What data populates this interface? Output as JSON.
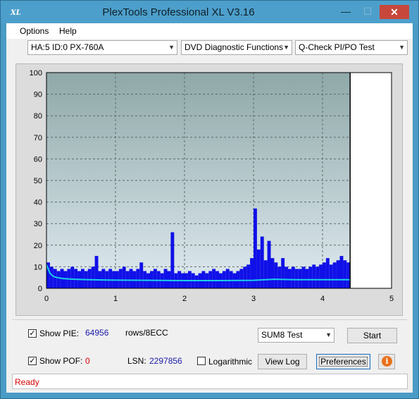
{
  "window": {
    "app_icon_text": "XL",
    "title": "PlexTools Professional XL V3.16",
    "minimize_glyph": "—",
    "maximize_glyph": "☐",
    "close_glyph": "✕"
  },
  "menu": {
    "options": "Options",
    "help": "Help"
  },
  "toolbar": {
    "drive": "HA:5 ID:0  PX-760A",
    "function": "DVD Diagnostic Functions",
    "test": "Q-Check PI/PO Test"
  },
  "chart_data": {
    "type": "area",
    "title": "",
    "xlabel": "",
    "ylabel": "",
    "xlim": [
      0,
      5
    ],
    "ylim": [
      0,
      100
    ],
    "x_ticks": [
      "0",
      "1",
      "2",
      "3",
      "4",
      "5"
    ],
    "y_ticks": [
      "100",
      "90",
      "80",
      "70",
      "60",
      "50",
      "40",
      "30",
      "20",
      "10",
      "0"
    ],
    "grid": true,
    "scan_end_x": 4.4,
    "colors": {
      "pie_bars": "#1010e8",
      "average_line": "#19d0e8",
      "background_top": "#8fa8a8",
      "background_bottom": "#dfeaf0"
    },
    "series": [
      {
        "values_x": [
          0.0,
          0.05,
          0.1,
          0.15,
          0.2,
          0.25,
          0.3,
          0.35,
          0.4,
          0.45,
          0.5,
          0.55,
          0.6,
          0.65,
          0.7,
          0.75,
          0.8,
          0.85,
          0.9,
          0.95,
          1.0,
          1.05,
          1.1,
          1.15,
          1.2,
          1.25,
          1.3,
          1.35,
          1.4,
          1.45,
          1.5,
          1.55,
          1.6,
          1.65,
          1.7,
          1.75,
          1.8,
          1.85,
          1.9,
          1.95,
          2.0,
          2.05,
          2.1,
          2.15,
          2.2,
          2.25,
          2.3,
          2.35,
          2.4,
          2.45,
          2.5,
          2.55,
          2.6,
          2.65,
          2.7,
          2.75,
          2.8,
          2.85,
          2.9,
          2.95,
          3.0,
          3.05,
          3.1,
          3.15,
          3.2,
          3.25,
          3.3,
          3.35,
          3.4,
          3.45,
          3.5,
          3.55,
          3.6,
          3.65,
          3.7,
          3.75,
          3.8,
          3.85,
          3.9,
          3.95,
          4.0,
          4.05,
          4.1,
          4.15,
          4.2,
          4.25,
          4.3,
          4.35,
          4.4
        ],
        "values_y": [
          12,
          10,
          9,
          8,
          9,
          8,
          9,
          10,
          9,
          8,
          9,
          8,
          9,
          10,
          15,
          8,
          9,
          8,
          9,
          8,
          8,
          9,
          10,
          8,
          9,
          8,
          9,
          12,
          8,
          7,
          8,
          9,
          8,
          7,
          9,
          8,
          26,
          7,
          8,
          7,
          7,
          8,
          7,
          6,
          7,
          8,
          7,
          8,
          9,
          8,
          7,
          8,
          9,
          8,
          7,
          8,
          9,
          10,
          11,
          14,
          37,
          18,
          24,
          13,
          22,
          14,
          12,
          10,
          14,
          10,
          9,
          10,
          9,
          9,
          10,
          9,
          10,
          11,
          10,
          11,
          12,
          14,
          11,
          12,
          13,
          15,
          13,
          12,
          10
        ]
      },
      {
        "values_x": [
          0.0,
          0.05,
          0.1,
          0.15,
          0.25,
          0.4,
          0.6,
          0.8,
          1.0,
          1.5,
          2.0,
          2.5,
          3.0,
          3.3,
          3.6,
          4.0,
          4.4
        ],
        "values_y": [
          11,
          7,
          5.5,
          5,
          4.5,
          4.2,
          4,
          3.9,
          3.8,
          3.7,
          3.6,
          3.6,
          3.7,
          4.2,
          4.0,
          4.0,
          4.0
        ]
      }
    ]
  },
  "controls": {
    "show_pie_label": "Show PIE:",
    "show_pie_checked": "✓",
    "pie_value": "64956",
    "pie_unit": "rows/8ECC",
    "show_pof_label": "Show POF:",
    "show_pof_checked": "✓",
    "pof_value": "0",
    "lsn_label": "LSN:",
    "lsn_value": "2297856",
    "logarithmic_label": "Logarithmic",
    "sum_test": "SUM8 Test",
    "start_label": "Start",
    "view_log_label": "View Log",
    "preferences_label": "Preferences",
    "info_glyph": "i"
  },
  "status": {
    "text": "Ready"
  }
}
